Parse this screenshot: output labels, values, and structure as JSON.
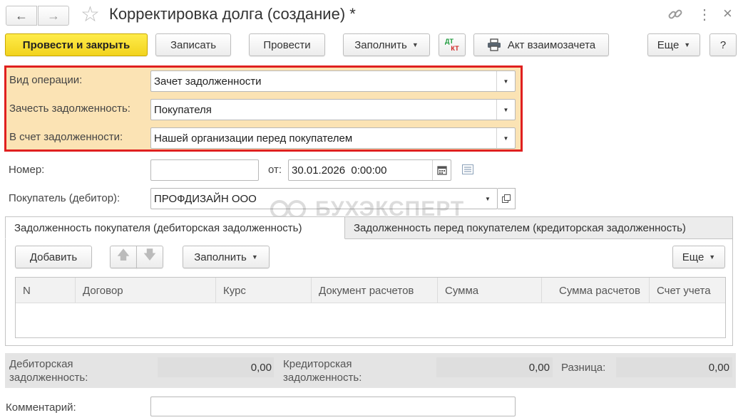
{
  "window": {
    "title": "Корректировка долга (создание) *",
    "nav_back_icon": "arrow-left-icon",
    "nav_forward_icon": "arrow-right-icon",
    "favorite_icon": "star-icon",
    "link_icon": "link-icon",
    "more_icon": "vertical-dots-icon",
    "close_icon": "close-icon"
  },
  "toolbar": {
    "post_close_label": "Провести и закрыть",
    "save_label": "Записать",
    "post_label": "Провести",
    "fill_label": "Заполнить",
    "dtkt_top": "ДТ",
    "dtkt_bottom": "КТ",
    "act_label": "Акт взаимозачета",
    "more_label": "Еще",
    "help_label": "?"
  },
  "form": {
    "operation_label": "Вид операции:",
    "operation_value": "Зачет задолженности",
    "offset_label": "Зачесть задолженность:",
    "offset_value": "Покупателя",
    "account_label": "В счет задолженности:",
    "account_value": "Нашей организации перед покупателем",
    "number_label": "Номер:",
    "number_value": "",
    "date_label": "от:",
    "date_value": "30.01.2026  0:00:00",
    "buyer_label": "Покупатель (дебитор):",
    "buyer_value": "ПРОФДИЗАЙН ООО",
    "comment_label": "Комментарий:",
    "comment_value": ""
  },
  "watermark": "БУХЭКСПЕРТ",
  "tabs": [
    {
      "label": "Задолженность покупателя (дебиторская задолженность)",
      "active": true
    },
    {
      "label": "Задолженность перед покупателем (кредиторская задолженность)",
      "active": false
    }
  ],
  "table_toolbar": {
    "add_label": "Добавить",
    "fill_label": "Заполнить",
    "more_label": "Еще"
  },
  "table": {
    "columns": [
      "N",
      "Договор",
      "Курс",
      "Документ расчетов",
      "Сумма",
      "Сумма расчетов",
      "Счет учета"
    ],
    "rows": []
  },
  "totals": {
    "debit_label": "Дебиторская задолженность:",
    "debit_value": "0,00",
    "credit_label": "Кредиторская задолженность:",
    "credit_value": "0,00",
    "diff_label": "Разница:",
    "diff_value": "0,00"
  },
  "colors": {
    "highlight_bg": "#fbe3b4",
    "highlight_border": "#e0201f",
    "primary_button": "#f5d923",
    "totals_bg": "#e4e4e4"
  }
}
